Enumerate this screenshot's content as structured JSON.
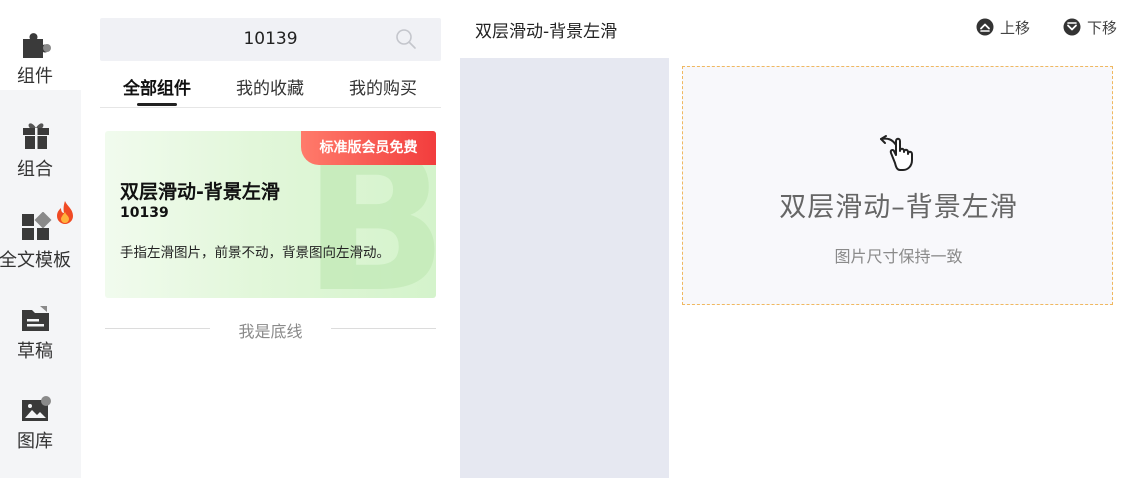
{
  "sidebar": {
    "items": [
      {
        "label": "组件",
        "icon": "puzzle-icon"
      },
      {
        "label": "组合",
        "icon": "gift-icon"
      },
      {
        "label": "全文模板",
        "icon": "template-grid-icon"
      },
      {
        "label": "草稿",
        "icon": "draft-folder-icon"
      },
      {
        "label": "图库",
        "icon": "image-gallery-icon"
      }
    ],
    "active_index": 0,
    "hot_icon": "fire-icon"
  },
  "search": {
    "value": "10139",
    "icon": "search-icon"
  },
  "tabs": [
    {
      "label": "全部组件"
    },
    {
      "label": "我的收藏"
    },
    {
      "label": "我的购买"
    }
  ],
  "component_card": {
    "badge": "标准版会员免费",
    "title": "双层滑动-背景左滑",
    "id": "10139",
    "description": "手指左滑图片，前景不动，背景图向左滑动。",
    "watermark": "B"
  },
  "list_end_text": "我是底线",
  "editor": {
    "title": "双层滑动-背景左滑",
    "move_up_label": "上移",
    "move_down_label": "下移",
    "preview_title": "双层滑动–背景左滑",
    "preview_subtitle": "图片尺寸保持一致"
  },
  "colors": {
    "badge_start": "#ff7b6b",
    "badge_end": "#f23d3d",
    "card_bg": "#e2f7da",
    "preview_border": "#f0b860",
    "rail_bg": "#f4f5f7",
    "stage_side_bg": "#e6e8f1"
  }
}
